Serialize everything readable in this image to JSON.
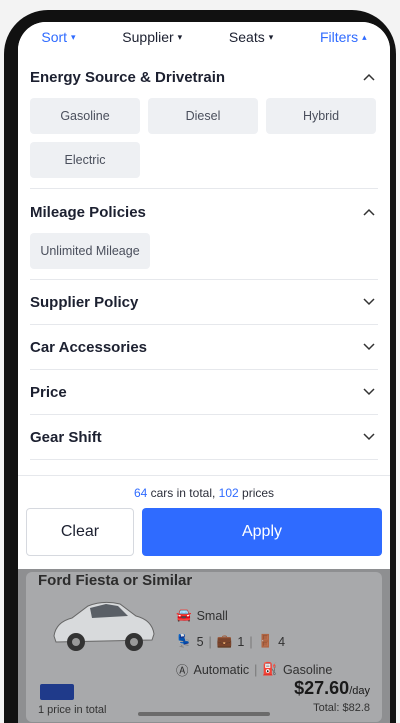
{
  "filter_bar": {
    "sort": "Sort",
    "supplier": "Supplier",
    "seats": "Seats",
    "filters": "Filters"
  },
  "sections": {
    "energy": {
      "title": "Energy Source & Drivetrain",
      "options": [
        "Gasoline",
        "Diesel",
        "Hybrid",
        "Electric"
      ]
    },
    "mileage": {
      "title": "Mileage Policies",
      "options": [
        "Unlimited Mileage"
      ]
    },
    "collapsed": [
      "Supplier Policy",
      "Car Accessories",
      "Price",
      "Gear Shift"
    ]
  },
  "summary": {
    "cars_count": "64",
    "cars_text": " cars in total, ",
    "prices_count": "102",
    "prices_text": " prices"
  },
  "buttons": {
    "clear": "Clear",
    "apply": "Apply"
  },
  "car": {
    "title": "Ford Fiesta or Similar",
    "size": "Small",
    "seats": "5",
    "bags": "1",
    "doors": "4",
    "transmission": "Automatic",
    "fuel": "Gasoline",
    "price": "$27.60",
    "per": "/day",
    "total": "Total: $82.8",
    "price_count": "1 price in total"
  },
  "colors": {
    "accent": "#2f6bff",
    "chip_bg": "#eef0f3"
  }
}
